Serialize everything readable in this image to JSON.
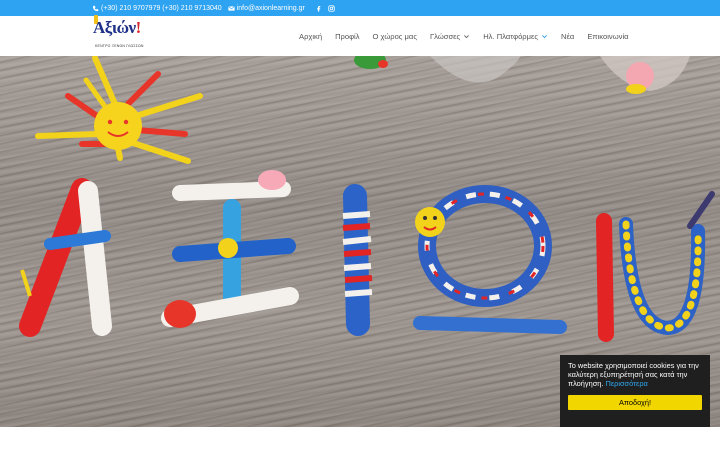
{
  "topbar": {
    "phones": "(+30) 210 9707979 (+30) 210 9713040",
    "email": "info@axionlearning.gr",
    "social": [
      "facebook-icon",
      "instagram-icon"
    ]
  },
  "logo": {
    "brand": "Αξιών",
    "exclaim": "!",
    "tagline": "ΚΕΝΤΡΟ ΞΕΝΩΝ ΓΛΩΣΣΩΝ"
  },
  "nav": {
    "items": [
      {
        "label": "Αρχική",
        "active": true,
        "dropdown": false
      },
      {
        "label": "Προφίλ",
        "active": false,
        "dropdown": false
      },
      {
        "label": "Ο χώρος μας",
        "active": false,
        "dropdown": false
      },
      {
        "label": "Γλώσσες",
        "active": false,
        "dropdown": true
      },
      {
        "label": "Ηλ. Πλατφόρμες",
        "active": true,
        "dropdown": true
      },
      {
        "label": "Νέα",
        "active": false,
        "dropdown": false
      },
      {
        "label": "Επικοινωνία",
        "active": false,
        "dropdown": false
      }
    ]
  },
  "cookie": {
    "message": "Το website χρησιμοποιεί cookies για την καλύτερη εξυπηρέτησή σας κατά την πλοήγηση.",
    "more": "Περισσότερα",
    "accept": "Αποδοχή!"
  },
  "colors": {
    "topbar": "#2ea3f2",
    "accent": "#2ea3f2",
    "cookie_bg": "#1f1f1f",
    "cookie_button": "#f1d600"
  }
}
